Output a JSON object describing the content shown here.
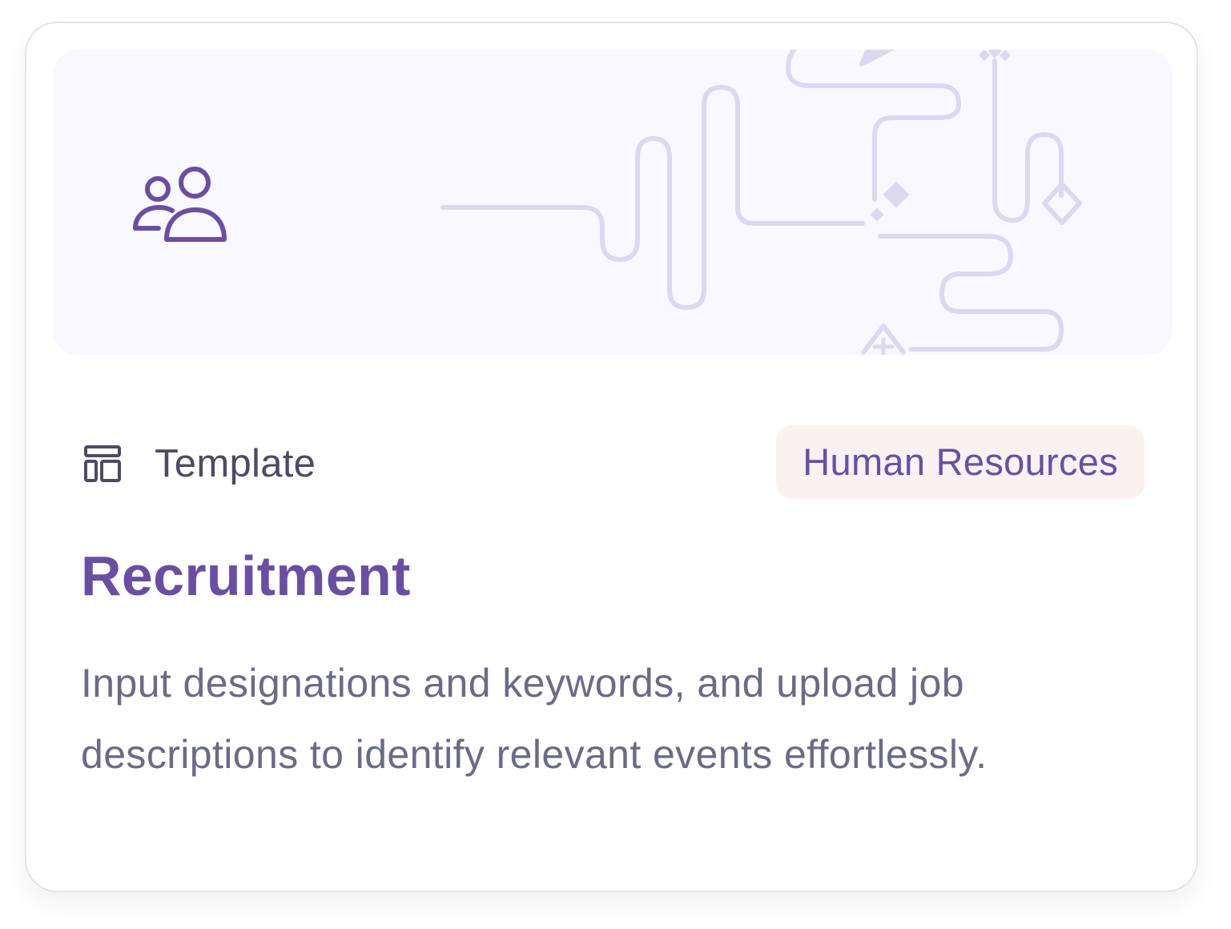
{
  "card": {
    "type_label": "Template",
    "tag_label": "Human Resources",
    "title": "Recruitment",
    "description": "Input designations and keywords, and upload job descriptions to identify relevant events effortlessly."
  },
  "icons": {
    "category": "users-icon",
    "type": "layout-template-icon"
  },
  "colors": {
    "accent": "#684fa4",
    "tag_background": "#fdf0f1",
    "banner_background": "#f9f8fe",
    "banner_lines": "#dcd8f0",
    "body_text": "#6a6b86",
    "type_text": "#4c4b63"
  }
}
